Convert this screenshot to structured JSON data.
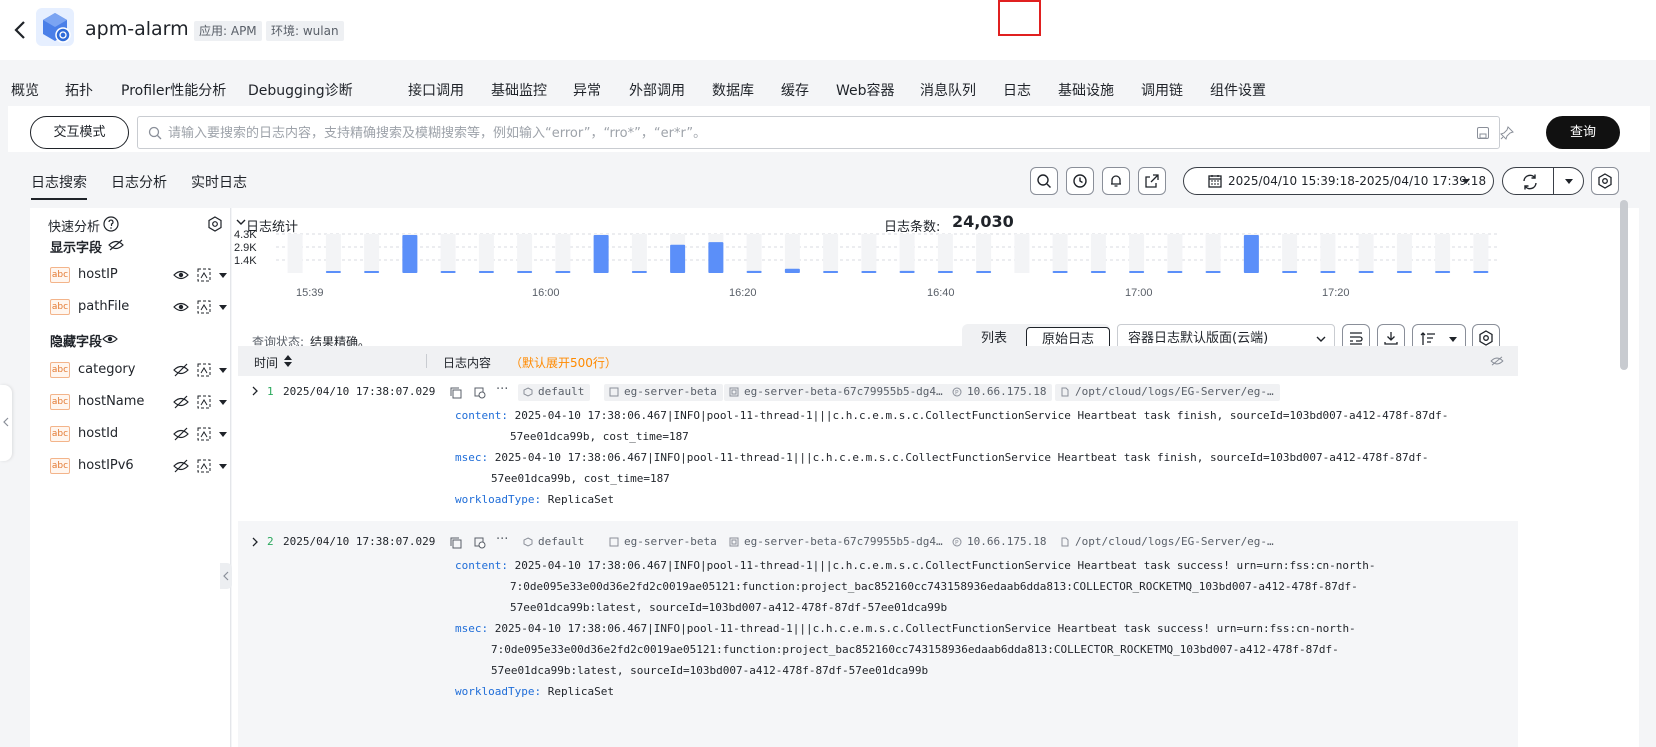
{
  "header": {
    "app_name": "apm-alarm",
    "tag_app": "应用: APM",
    "tag_env": "环境: wulan"
  },
  "nav": {
    "items": [
      "概览",
      "拓扑",
      "Profiler性能分析",
      "Debugging诊断",
      "接口调用",
      "基础监控",
      "异常",
      "外部调用",
      "数据库",
      "缓存",
      "Web容器",
      "消息队列",
      "日志",
      "基础设施",
      "调用链",
      "组件设置"
    ],
    "active": "日志"
  },
  "query": {
    "mode_button": "交互模式",
    "placeholder": "请输入要搜索的日志内容，支持精确搜索及模糊搜索等，例如输入“error”，“rro*”，“er*r”。",
    "value": "",
    "search_button": "查询"
  },
  "subtabs": [
    "日志搜索",
    "日志分析",
    "实时日志"
  ],
  "time_range": "2025/04/10 15:39:18-2025/04/10 17:39:18",
  "left_panel": {
    "title": "快速分析",
    "shown_title": "显示字段",
    "hidden_title": "隐藏字段",
    "shown_fields": [
      "hostIP",
      "pathFile"
    ],
    "hidden_fields": [
      "category",
      "hostName",
      "hostId",
      "hostIPv6"
    ],
    "field_type": "abc"
  },
  "stats": {
    "title": "日志统计",
    "count_label": "日志条数:",
    "count": "24,030"
  },
  "chart_data": {
    "type": "bar",
    "y_ticks": [
      "4.3K",
      "2.9K",
      "1.4K"
    ],
    "x_ticks": [
      "15:39",
      "16:00",
      "16:20",
      "16:40",
      "17:00",
      "17:20"
    ],
    "values": [
      0,
      60,
      120,
      4300,
      30,
      60,
      60,
      120,
      4300,
      30,
      3200,
      3500,
      240,
      480,
      30,
      60,
      240,
      60,
      60,
      0,
      60,
      60,
      60,
      60,
      60,
      4300,
      60,
      60,
      60,
      120,
      60,
      60
    ],
    "bar_color": "#5b8ff9",
    "ylim": [
      0,
      4300
    ]
  },
  "result": {
    "state_label": "查询状态:",
    "state_value": "结果精确。",
    "view_list": "列表",
    "view_raw": "原始日志",
    "layout_select": "容器日志默认版面(云端)"
  },
  "table": {
    "col_time": "时间",
    "col_content": "日志内容",
    "col_note": "（默认展开500行）"
  },
  "rows": [
    {
      "num": "1",
      "time": "2025/04/10 17:38:07.029",
      "tags": [
        "default",
        "eg-server-beta",
        "eg-server-beta-67c79955b5-dg4…",
        "10.66.175.18",
        "/opt/cloud/logs/EG-Server/eg-…"
      ],
      "content_key": "content:",
      "content_lines": [
        "2025-04-10 17:38:06.467|INFO|pool-11-thread-1|||c.h.c.e.m.s.c.CollectFunctionService Heartbeat task finish, sourceId=103bd007-a412-478f-87df-",
        "57ee01dca99b, cost_time=187"
      ],
      "msec_key": "msec:",
      "msec_lines": [
        "2025-04-10 17:38:06.467|INFO|pool-11-thread-1|||c.h.c.e.m.s.c.CollectFunctionService Heartbeat task finish, sourceId=103bd007-a412-478f-87df-",
        "57ee01dca99b, cost_time=187"
      ],
      "wl_key": "workloadType:",
      "wl_value": "ReplicaSet"
    },
    {
      "num": "2",
      "time": "2025/04/10 17:38:07.029",
      "tags": [
        "default",
        "eg-server-beta",
        "eg-server-beta-67c79955b5-dg4…",
        "10.66.175.18",
        "/opt/cloud/logs/EG-Server/eg-…"
      ],
      "content_key": "content:",
      "content_lines": [
        "2025-04-10 17:38:06.467|INFO|pool-11-thread-1|||c.h.c.e.m.s.c.CollectFunctionService Heartbeat task success! urn=urn:fss:cn-north-",
        "7:0de095e33e00d36e2fd2c0019ae05121:function:project_bac852160cc743158936edaab6dda813:COLLECTOR_ROCKETMQ_103bd007-a412-478f-87df-",
        "57ee01dca99b:latest, sourceId=103bd007-a412-478f-87df-57ee01dca99b"
      ],
      "msec_key": "msec:",
      "msec_lines": [
        "2025-04-10 17:38:06.467|INFO|pool-11-thread-1|||c.h.c.e.m.s.c.CollectFunctionService Heartbeat task success! urn=urn:fss:cn-north-",
        "7:0de095e33e00d36e2fd2c0019ae05121:function:project_bac852160cc743158936edaab6dda813:COLLECTOR_ROCKETMQ_103bd007-a412-478f-87df-",
        "57ee01dca99b:latest, sourceId=103bd007-a412-478f-87df-57ee01dca99b"
      ],
      "wl_key": "workloadType:",
      "wl_value": "ReplicaSet"
    }
  ]
}
